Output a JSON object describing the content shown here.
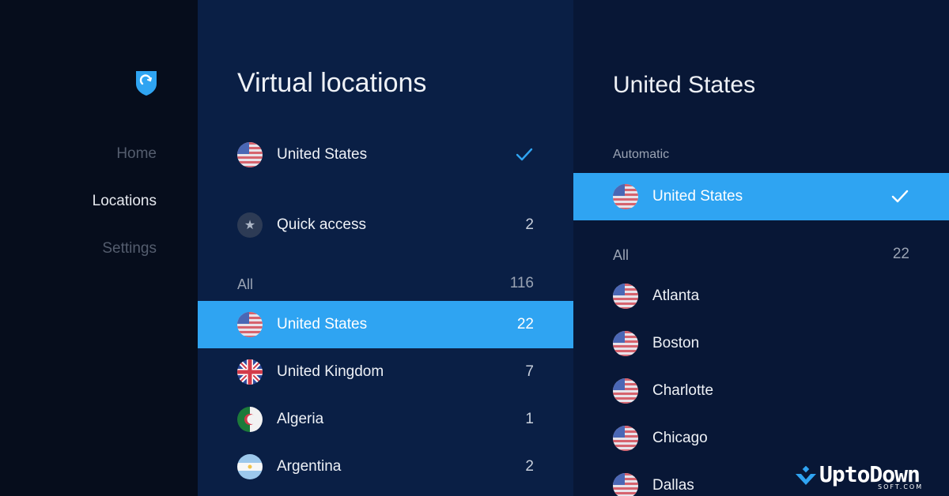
{
  "sidebar": {
    "items": [
      {
        "label": "Home",
        "active": false
      },
      {
        "label": "Locations",
        "active": true
      },
      {
        "label": "Settings",
        "active": false
      }
    ]
  },
  "locations": {
    "title": "Virtual locations",
    "current": {
      "label": "United States",
      "flag": "us-flag-icon",
      "checked": true
    },
    "quick_access": {
      "label": "Quick access",
      "count": "2",
      "icon": "star-icon"
    },
    "all": {
      "label": "All",
      "count": "116"
    },
    "countries": [
      {
        "label": "United States",
        "count": "22",
        "flag": "us-flag-icon",
        "selected": true
      },
      {
        "label": "United Kingdom",
        "count": "7",
        "flag": "uk-flag-icon",
        "selected": false
      },
      {
        "label": "Algeria",
        "count": "1",
        "flag": "algeria-flag-icon",
        "selected": false
      },
      {
        "label": "Argentina",
        "count": "2",
        "flag": "argentina-flag-icon",
        "selected": false
      }
    ]
  },
  "detail": {
    "title": "United States",
    "automatic_label": "Automatic",
    "automatic": {
      "label": "United States",
      "flag": "us-flag-icon",
      "checked": true
    },
    "all": {
      "label": "All",
      "count": "22"
    },
    "cities": [
      "Atlanta",
      "Boston",
      "Charlotte",
      "Chicago",
      "Dallas"
    ]
  },
  "watermark": {
    "text": "UptoDown",
    "sub": "SOFT.COM"
  },
  "colors": {
    "sidebar_bg": "#060d1c",
    "middle_bg": "#0a1f45",
    "right_bg": "#081736",
    "accent": "#2fa4f2"
  }
}
